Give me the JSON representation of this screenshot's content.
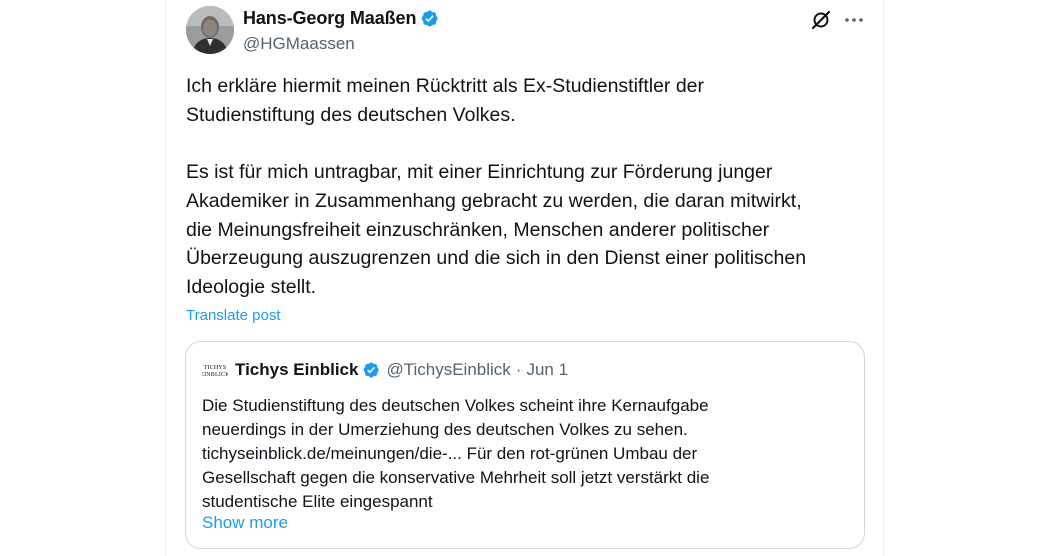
{
  "author": {
    "display_name": "Hans-Georg Maaßen",
    "handle": "@HGMaassen"
  },
  "actions": {
    "grok_icon": "grok-icon",
    "more_icon": "more-icon"
  },
  "tweet": {
    "text": "Ich erkläre hiermit meinen Rücktritt als Ex-Studienstiftler der\nStudienstiftung des deutschen Volkes.\n\nEs ist für mich untragbar, mit einer Einrichtung zur Förderung junger\nAkademiker in Zusammenhang gebracht zu werden, die daran mitwirkt,\ndie Meinungsfreiheit einzuschränken, Menschen anderer politischer\nÜberzeugung auszugrenzen und die sich in den Dienst einer politischen\nIdeologie stellt.",
    "translate_label": "Translate post"
  },
  "quote": {
    "avatar_text": "TICHYS\nEINBLICK",
    "display_name": "Tichys Einblick",
    "handle": "@TichysEinblick",
    "separator": "·",
    "date": "Jun 1",
    "text": "Die Studienstiftung des deutschen Volkes scheint ihre Kernaufgabe\nneuerdings in der Umerziehung des deutschen Volkes zu sehen.\ntichyseinblick.de/meinungen/die-... Für den rot-grünen Umbau der\nGesellschaft gegen die konservative Mehrheit soll jetzt verstärkt die\nstudentische Elite eingespannt",
    "show_more_label": "Show more"
  },
  "colors": {
    "accent": "#1d9bf0",
    "text_primary": "#0f1419",
    "text_secondary": "#536471",
    "border": "#cfd9de"
  }
}
